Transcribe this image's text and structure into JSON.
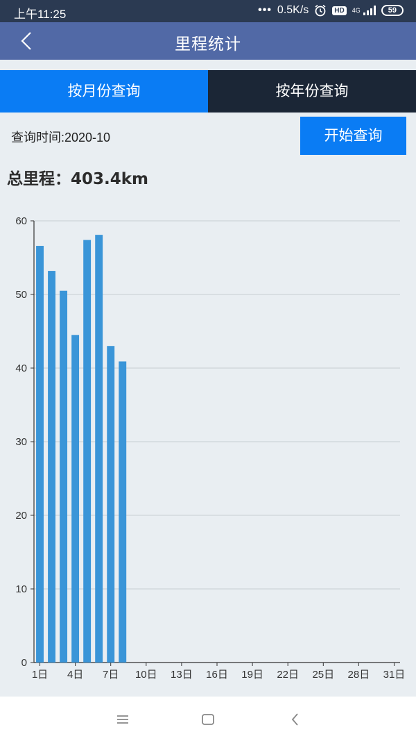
{
  "status_bar": {
    "time": "上午11:25",
    "network_speed": "0.5K/s",
    "hd_label": "HD",
    "network_type": "4G",
    "battery": "59"
  },
  "header": {
    "title": "里程统计",
    "back_icon": "chevron-left-icon"
  },
  "tabs": [
    {
      "label": "按月份查询",
      "active": true
    },
    {
      "label": "按年份查询",
      "active": false
    }
  ],
  "query": {
    "label": "查询时间:2020-10",
    "button_label": "开始查询"
  },
  "total": {
    "text": "总里程：403.4km"
  },
  "chart_data": {
    "type": "bar",
    "categories": [
      "1日",
      "2日",
      "3日",
      "4日",
      "5日",
      "6日",
      "7日",
      "8日",
      "9日",
      "10日",
      "11日",
      "12日",
      "13日",
      "14日",
      "15日",
      "16日",
      "17日",
      "18日",
      "19日",
      "20日",
      "21日",
      "22日",
      "23日",
      "24日",
      "25日",
      "26日",
      "27日",
      "28日",
      "29日",
      "30日",
      "31日"
    ],
    "tick_labels": [
      "1日",
      "4日",
      "7日",
      "10日",
      "13日",
      "16日",
      "19日",
      "22日",
      "25日",
      "28日",
      "31日"
    ],
    "values": [
      56.6,
      53.2,
      50.5,
      44.5,
      57.4,
      58.1,
      43.0,
      40.9,
      0,
      0,
      0,
      0,
      0,
      0,
      0,
      0,
      0,
      0,
      0,
      0,
      0,
      0,
      0,
      0,
      0,
      0,
      0,
      0,
      0,
      0,
      0
    ],
    "ylim": [
      0,
      60
    ],
    "yticks": [
      0,
      10,
      20,
      30,
      40,
      50,
      60
    ],
    "grid": true,
    "bar_color": "#3a95d8",
    "title": "",
    "xlabel": "",
    "ylabel": ""
  },
  "bottom_nav": {
    "menu_icon": "menu-icon",
    "home_icon": "home-square-icon",
    "back_icon": "back-chevron-icon"
  },
  "colors": {
    "accent": "#0a7cf4",
    "header": "#5169a6",
    "dark_tab": "#1b2636"
  }
}
